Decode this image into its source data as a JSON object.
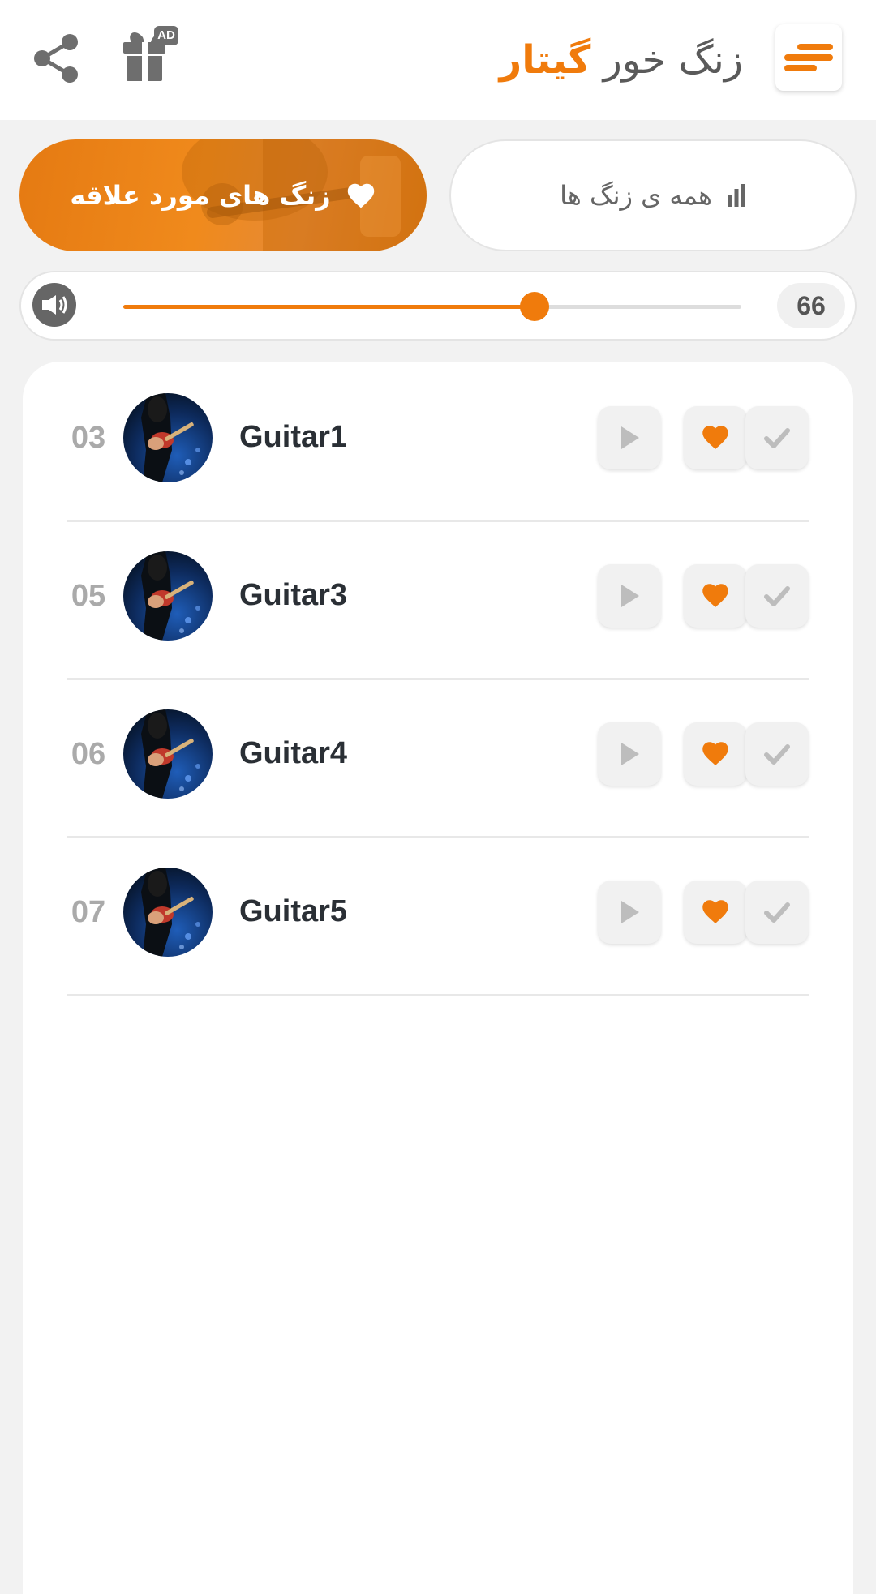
{
  "header": {
    "title_part1": "زنگ خور",
    "title_part2": "گیتار",
    "ad_badge": "AD",
    "icons": {
      "menu": "menu-bars-icon",
      "gift": "gift-icon",
      "share": "share-icon"
    }
  },
  "tabs": {
    "favorites_label": "زنگ های مورد علاقه",
    "all_label": "همه ی زنگ ها"
  },
  "volume": {
    "value": "66",
    "level": 0.665
  },
  "ringtones": [
    {
      "number": "03",
      "title": "Guitar1"
    },
    {
      "number": "05",
      "title": "Guitar3"
    },
    {
      "number": "06",
      "title": "Guitar4"
    },
    {
      "number": "07",
      "title": "Guitar5"
    }
  ],
  "colors": {
    "accent": "#f07b0c",
    "title_gray": "#5a5a5a",
    "icon_gray": "#666666",
    "button_bg": "#f1f1f1",
    "background": "#f2f2f2"
  }
}
